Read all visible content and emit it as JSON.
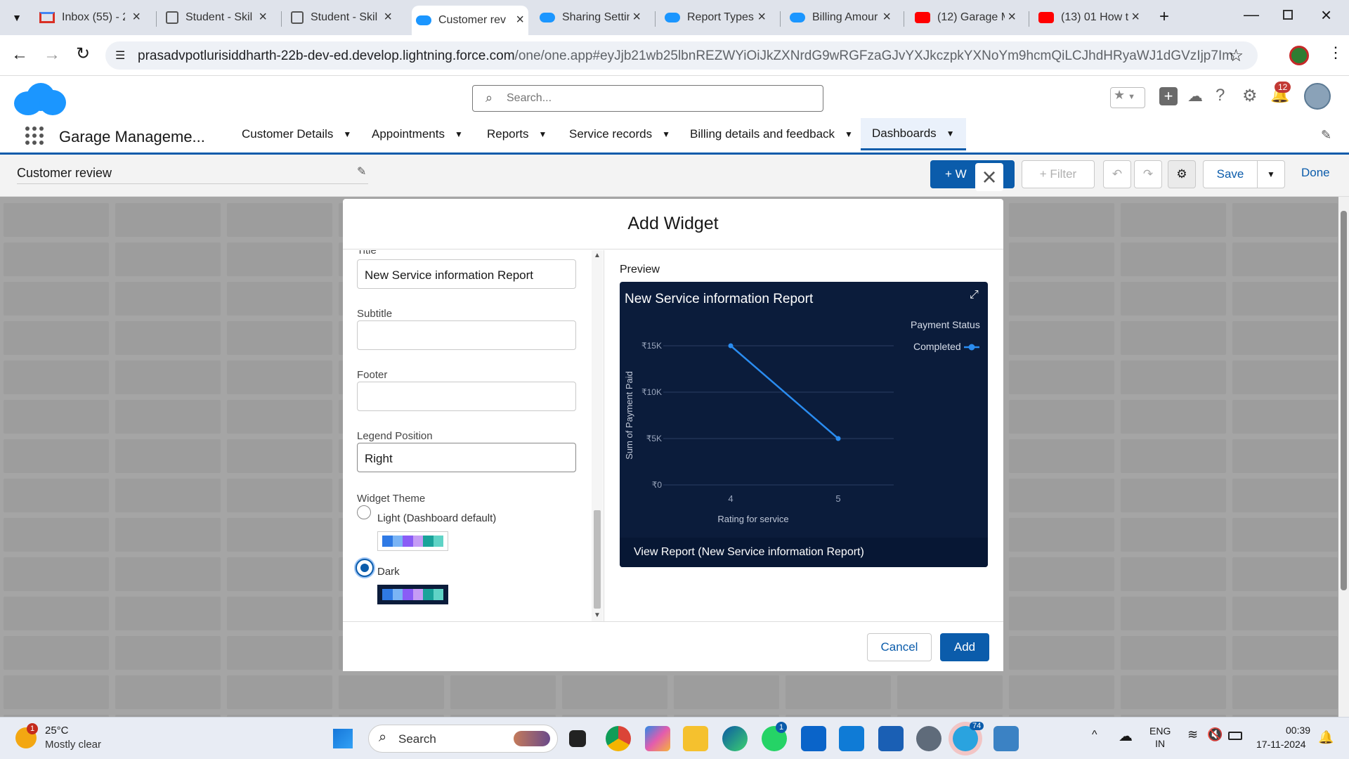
{
  "browser": {
    "tabs": [
      {
        "label": "Inbox (55) - 2",
        "icon": "gmail-icon"
      },
      {
        "label": "Student - Skil",
        "icon": "page-icon"
      },
      {
        "label": "Student - Skil",
        "icon": "page-icon"
      },
      {
        "label": "Customer rev",
        "icon": "salesforce-icon"
      },
      {
        "label": "Sharing Settin",
        "icon": "salesforce-icon"
      },
      {
        "label": "Report Types",
        "icon": "salesforce-icon"
      },
      {
        "label": "Billing Amour",
        "icon": "salesforce-icon"
      },
      {
        "label": "(12) Garage M",
        "icon": "youtube-icon"
      },
      {
        "label": "(13) 01 How t",
        "icon": "youtube-icon"
      }
    ],
    "url_domain": "prasadvpotlurisiddharth-22b-dev-ed.develop.lightning.force.com",
    "url_path": "/one/one.app#eyJjb21wb25lbnREZWYiOiJkZXNrdG9wRGFzaGJvYXJkczpkYXNoYm9hcmQiLCJhdHRyaWJ1dGVzIjp7ImRhc2hib2FyZElkIjoi..."
  },
  "sf": {
    "search_placeholder": "Search...",
    "app_name": "Garage Manageme...",
    "notification_count": "12",
    "nav": [
      "Customer Details",
      "Appointments",
      "Reports",
      "Service records",
      "Billing details and feedback",
      "Dashboards"
    ],
    "dashboard_title": "Customer review",
    "toolbar": {
      "widget": "+ W",
      "filter": "+ Filter",
      "save": "Save",
      "done": "Done"
    }
  },
  "modal": {
    "title": "Add Widget",
    "title_label": "Title",
    "title_value": "New Service information Report",
    "subtitle_label": "Subtitle",
    "subtitle_value": "",
    "footer_label": "Footer",
    "footer_value": "",
    "legend_label": "Legend Position",
    "legend_value": "Right",
    "theme_label": "Widget Theme",
    "theme_light": "Light (Dashboard default)",
    "theme_dark": "Dark",
    "selected_theme": "Dark",
    "preview_label": "Preview",
    "cancel": "Cancel",
    "add": "Add",
    "palette": [
      "#2f7ae5",
      "#7ab4f5",
      "#8a5cf6",
      "#c59cf5",
      "#1aa39a",
      "#5fd3c6"
    ]
  },
  "chart_data": {
    "type": "line",
    "title": "New Service information Report",
    "xlabel": "Rating for service",
    "ylabel": "Sum of Payment Paid",
    "categories": [
      "4",
      "5"
    ],
    "series": [
      {
        "name": "Completed",
        "values": [
          15000,
          5000
        ]
      }
    ],
    "yticks": [
      "₹0",
      "₹5K",
      "₹10K",
      "₹15K"
    ],
    "ylim": [
      0,
      15000
    ],
    "legend_title": "Payment Status",
    "legend_position": "right",
    "footer_link": "View Report (New Service information Report)",
    "colors": {
      "background": "#0b1c3b",
      "line": "#2a8cf0"
    }
  },
  "taskbar": {
    "weather_temp": "25°C",
    "weather_desc": "Mostly clear",
    "weather_badge": "1",
    "search": "Search",
    "lang": "ENG",
    "region": "IN",
    "time": "00:39",
    "date": "17-11-2024",
    "whatsapp_badge": "1",
    "telegram_badge": "74"
  }
}
